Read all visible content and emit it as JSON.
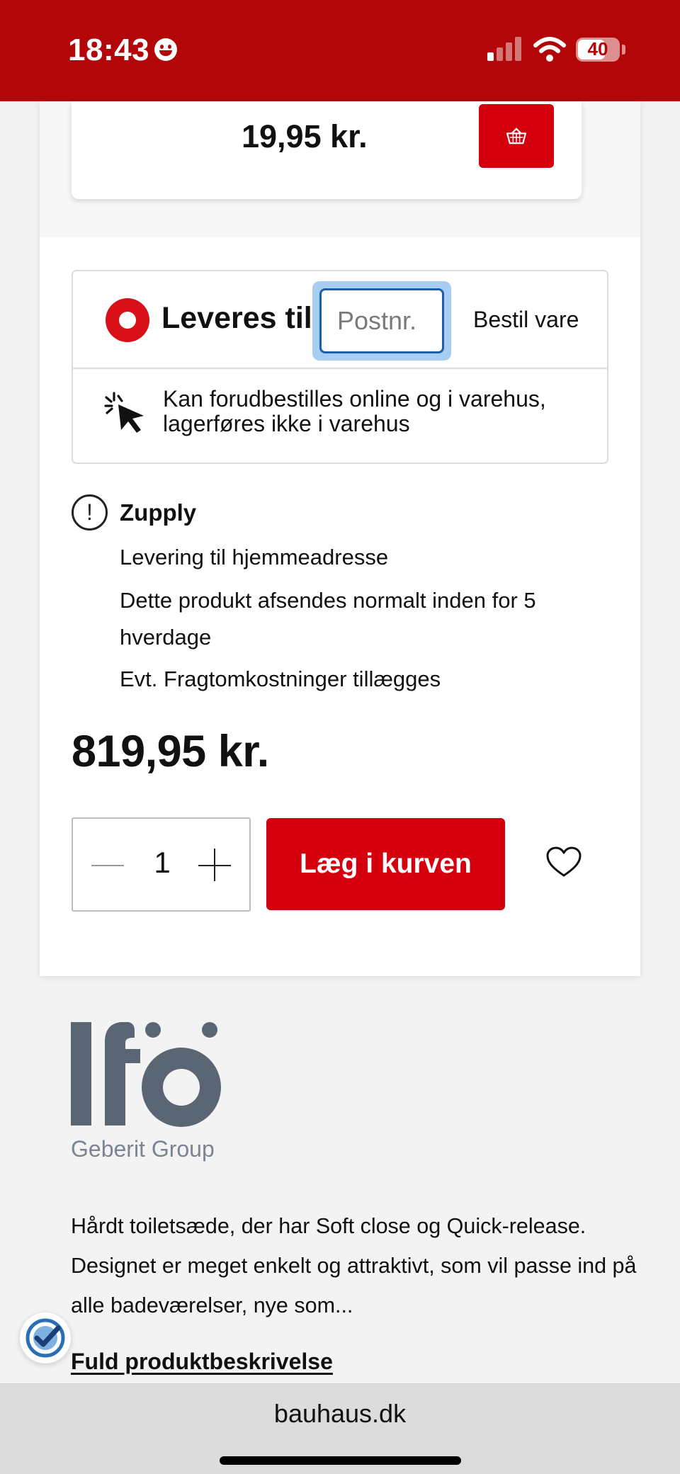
{
  "status_bar": {
    "time": "18:43",
    "battery": "40",
    "bg_color": "#b30608"
  },
  "variant": {
    "price": "19,95 kr.",
    "cart_icon": "basket-icon"
  },
  "delivery": {
    "label": "Leveres til:",
    "postal_placeholder": "Postnr.",
    "order_label": "Bestil vare",
    "preorder_text": "Kan forudbestilles online og i varehus, lagerføres ikke i varehus"
  },
  "shipping": {
    "carrier": "Zupply",
    "lines": [
      "Levering til hjemmeadresse",
      "Dette produkt afsendes normalt inden for 5 hverdage",
      "Evt. Fragtomkostninger tillægges"
    ]
  },
  "product": {
    "price": "819,95 kr.",
    "quantity": "1",
    "add_to_cart_label": "Læg i kurven",
    "accent_color": "#d4000d"
  },
  "brand": {
    "name": "Ifö",
    "group": "Geberit Group",
    "logo_color": "#5b6674"
  },
  "description": {
    "text": "Hårdt toiletsæde, der har Soft close og Quick-release. Designet er meget enkelt og attraktivt, som vil passe ind på alle badeværelser, nye som...",
    "link_label": "Fuld produktbeskrivelse"
  },
  "browser": {
    "url": "bauhaus.dk"
  }
}
